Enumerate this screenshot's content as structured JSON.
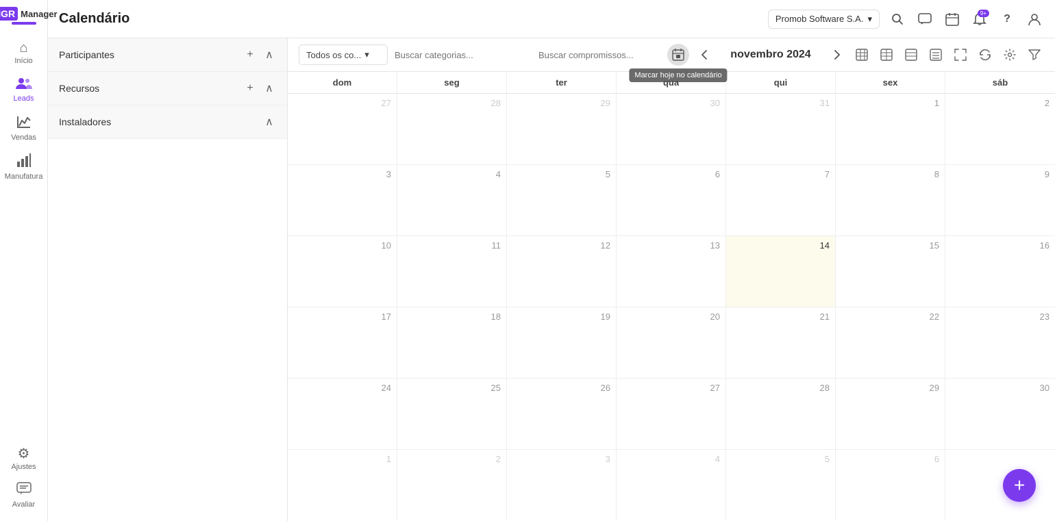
{
  "app": {
    "logo_mgr": "MGR",
    "logo_manager": "Manager"
  },
  "company": {
    "name": "Promob Software S.A.",
    "dropdown_icon": "▾"
  },
  "header": {
    "title": "Calendário"
  },
  "topbar_icons": {
    "search": "🔍",
    "chat": "💬",
    "calendar": "📅",
    "bell": "🔔",
    "bell_badge": "9+",
    "help": "?",
    "user": "👤"
  },
  "sidebar": {
    "items": [
      {
        "label": "Início",
        "icon": "⌂"
      },
      {
        "label": "Leads",
        "icon": "👥"
      },
      {
        "label": "Vendas",
        "icon": "✋"
      },
      {
        "label": "Manufatura",
        "icon": "📊"
      }
    ],
    "bottom": [
      {
        "label": "Ajustes",
        "icon": "⚙"
      },
      {
        "label": "Avaliar",
        "icon": "💬"
      }
    ]
  },
  "left_panel": {
    "sections": [
      {
        "title": "Participantes",
        "collapsible": true
      },
      {
        "title": "Recursos",
        "collapsible": true
      },
      {
        "title": "Instaladores",
        "collapsible": true
      }
    ]
  },
  "calendar": {
    "month_label": "novembro 2024",
    "filter_dropdown": "Todos os co...",
    "search_cat_placeholder": "Buscar categorias...",
    "search_comp_placeholder": "Buscar compromissos...",
    "tooltip": "Marcar hoje no calendário",
    "days_header": [
      "dom",
      "seg",
      "ter",
      "qua",
      "qui",
      "sex",
      "sáb"
    ],
    "view_icons": [
      "month_icon",
      "week_icon",
      "day_icon",
      "list_icon",
      "expand_icon",
      "refresh_icon",
      "settings_icon"
    ],
    "weeks": [
      [
        {
          "date": "27",
          "other": true
        },
        {
          "date": "28",
          "other": true
        },
        {
          "date": "29",
          "other": true
        },
        {
          "date": "30",
          "other": true
        },
        {
          "date": "31",
          "other": true
        },
        {
          "date": "1",
          "other": false
        },
        {
          "date": "2",
          "other": false
        }
      ],
      [
        {
          "date": "3",
          "other": false
        },
        {
          "date": "4",
          "other": false
        },
        {
          "date": "5",
          "other": false
        },
        {
          "date": "6",
          "other": false
        },
        {
          "date": "7",
          "other": false
        },
        {
          "date": "8",
          "other": false
        },
        {
          "date": "9",
          "other": false
        }
      ],
      [
        {
          "date": "10",
          "other": false
        },
        {
          "date": "11",
          "other": false
        },
        {
          "date": "12",
          "other": false
        },
        {
          "date": "13",
          "other": false
        },
        {
          "date": "14",
          "other": false,
          "today": true
        },
        {
          "date": "15",
          "other": false
        },
        {
          "date": "16",
          "other": false
        }
      ],
      [
        {
          "date": "17",
          "other": false
        },
        {
          "date": "18",
          "other": false
        },
        {
          "date": "19",
          "other": false
        },
        {
          "date": "20",
          "other": false
        },
        {
          "date": "21",
          "other": false
        },
        {
          "date": "22",
          "other": false
        },
        {
          "date": "23",
          "other": false
        }
      ],
      [
        {
          "date": "24",
          "other": false
        },
        {
          "date": "25",
          "other": false
        },
        {
          "date": "26",
          "other": false
        },
        {
          "date": "27",
          "other": false
        },
        {
          "date": "28",
          "other": false
        },
        {
          "date": "29",
          "other": false
        },
        {
          "date": "30",
          "other": false
        }
      ],
      [
        {
          "date": "1",
          "other": true
        },
        {
          "date": "2",
          "other": true
        },
        {
          "date": "3",
          "other": true
        },
        {
          "date": "4",
          "other": true
        },
        {
          "date": "5",
          "other": true
        },
        {
          "date": "6",
          "other": true
        },
        {
          "date": "",
          "other": true
        }
      ]
    ]
  },
  "fab": {
    "label": "+"
  }
}
